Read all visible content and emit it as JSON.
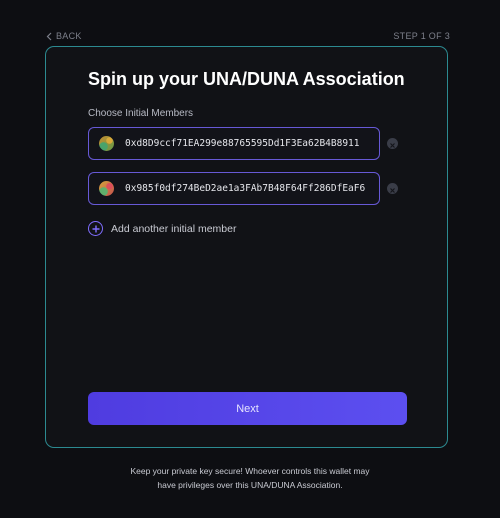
{
  "nav": {
    "back_label": "BACK",
    "step_label": "STEP 1 OF 3"
  },
  "form": {
    "title": "Spin up your UNA/DUNA Association",
    "members_label": "Choose Initial Members",
    "members": [
      {
        "address": "0xd8D9ccf71EA299e88765595Dd1F3Ea62B4B8911"
      },
      {
        "address": "0x985f0df274BeD2ae1a3FAb7B48F64Ff286DfEaF6"
      }
    ],
    "add_member_label": "Add another initial member",
    "next_label": "Next"
  },
  "footer": {
    "note_line1": "Keep your private key secure! Whoever controls this wallet may",
    "note_line2": "have privileges over this UNA/DUNA Association."
  },
  "icons": {
    "back": "chevron-left-icon",
    "remove": "close-icon",
    "add": "plus-circle-icon"
  },
  "colors": {
    "accent": "#5c4ff0",
    "card_border": "#2c8a90",
    "input_border": "#6759d6",
    "background": "#0d0e12"
  }
}
